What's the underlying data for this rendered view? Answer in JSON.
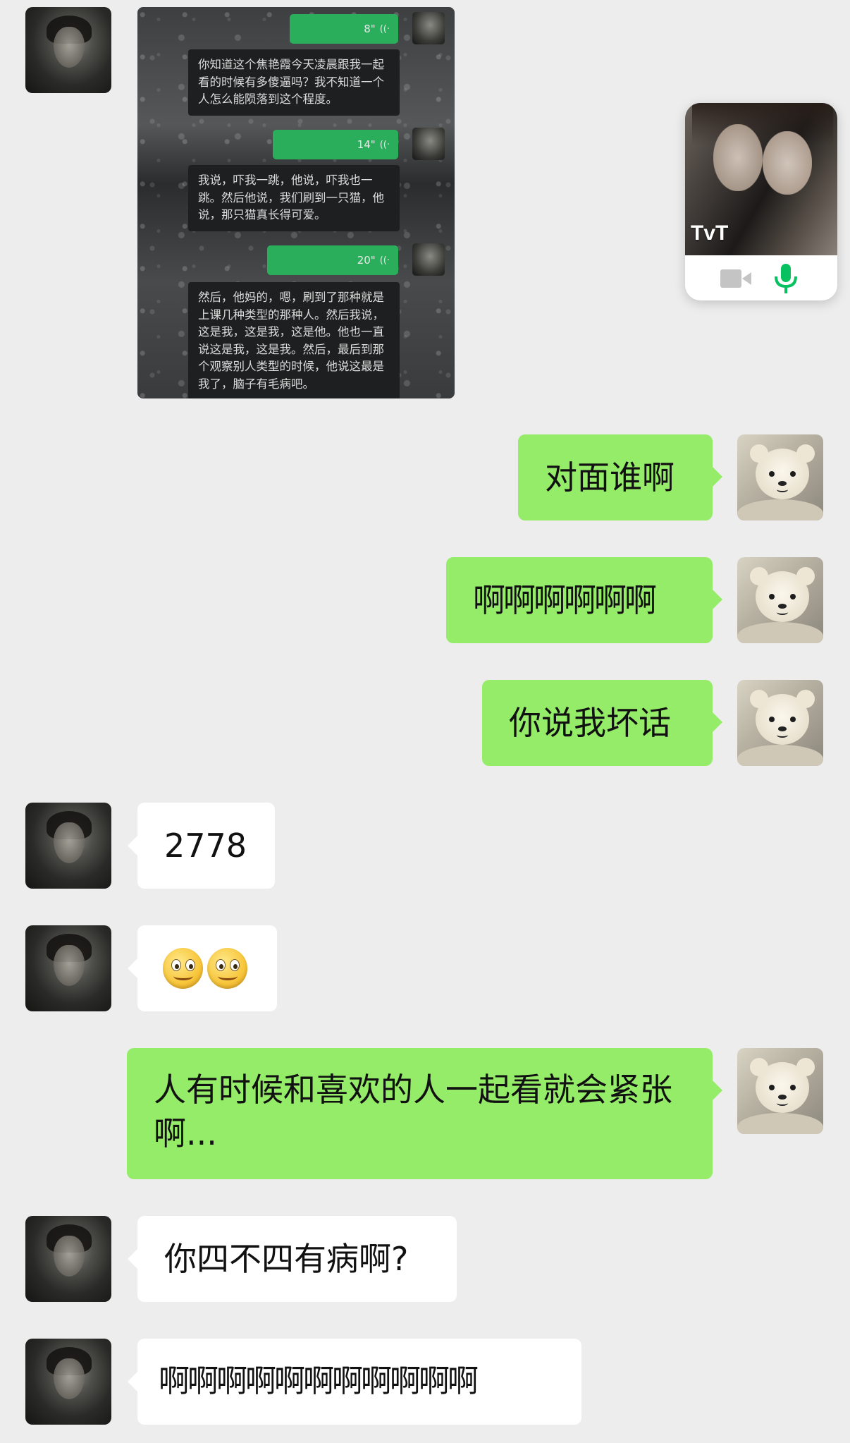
{
  "screenshot": {
    "voice_messages": [
      {
        "duration": "8\"",
        "transcript": "你知道这个焦艳霞今天凌晨跟我一起看的时候有多傻逼吗？我不知道一个人怎么能陨落到这个程度。"
      },
      {
        "duration": "14\"",
        "transcript": "我说，吓我一跳，他说，吓我也一跳。然后他说，我们刷到一只猫，他说，那只猫真长得可爱。"
      },
      {
        "duration": "20\"",
        "transcript": "然后，他妈的，嗯，刷到了那种就是上课几种类型的那种人。然后我说，这是我，这是我，这是他。他也一直说这是我，这是我。然后，最后到那个观察别人类型的时候，他说这最是我了，脑子有毛病吧。"
      }
    ],
    "wave_glyph": "((·"
  },
  "call": {
    "caption": "TvT",
    "camera_icon": "video-camera-icon",
    "mic_icon": "microphone-icon",
    "mic_color": "#07c160"
  },
  "messages": [
    {
      "side": "right",
      "text": "对面谁啊"
    },
    {
      "side": "right",
      "text": "啊啊啊啊啊啊"
    },
    {
      "side": "right",
      "text": "你说我坏话"
    },
    {
      "side": "left",
      "text": "2778"
    },
    {
      "side": "left",
      "emoji": [
        "smiley-emoji",
        "smiley-emoji"
      ]
    },
    {
      "side": "right",
      "text": "人有时候和喜欢的人一起看就会紧张啊..."
    },
    {
      "side": "left",
      "text": "你四不四有病啊?"
    },
    {
      "side": "left",
      "text": "啊啊啊啊啊啊啊啊啊啊啊"
    }
  ],
  "colors": {
    "background": "#ededed",
    "bubble_self": "#95ec69",
    "bubble_other": "#ffffff",
    "voice_bubble": "#2bae5c"
  }
}
